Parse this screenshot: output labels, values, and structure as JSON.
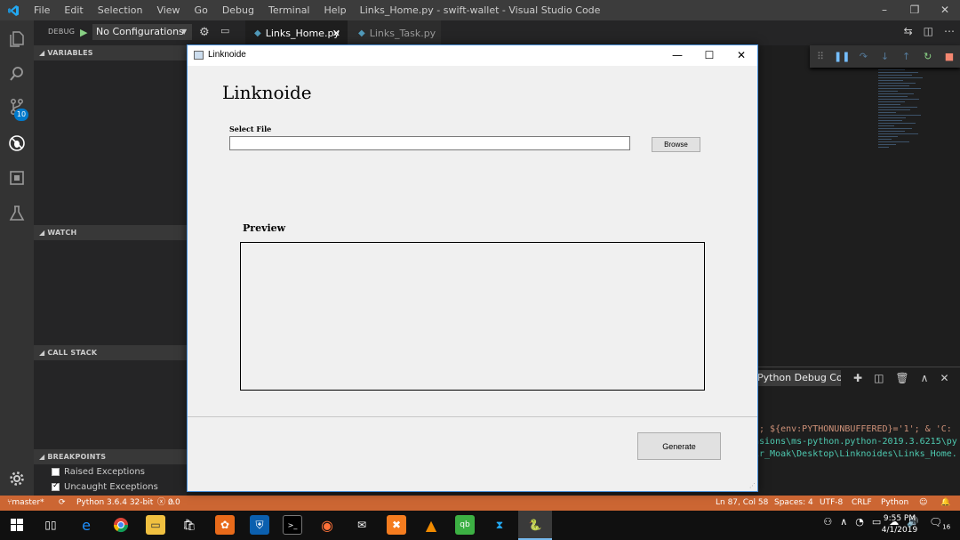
{
  "vscode": {
    "menu": [
      "File",
      "Edit",
      "Selection",
      "View",
      "Go",
      "Debug",
      "Terminal",
      "Help"
    ],
    "window_title": "Links_Home.py - swift-wallet - Visual Studio Code",
    "debug_label": "DEBUG",
    "debug_config": "No Configurations",
    "tabs": [
      {
        "label": "Links_Home.py",
        "active": true
      },
      {
        "label": "Links_Task.py",
        "active": false
      }
    ],
    "scm_badge": "10",
    "sidebar": {
      "variables": "VARIABLES",
      "watch": "WATCH",
      "call_stack": "CALL STACK",
      "breakpoints": "BREAKPOINTS",
      "bp_items": [
        {
          "label": "Raised Exceptions",
          "checked": false
        },
        {
          "label": "Uncaught Exceptions",
          "checked": true
        }
      ]
    },
    "panel": {
      "select": "Python Debug Console",
      "lines": [
        "'; ${env:PYTHONUNBUFFERED}='1'; & 'C:",
        "nsions\\ms-python.python-2019.3.6215\\py",
        "ir_Moak\\Desktop\\Linknoides\\Links_Home."
      ]
    },
    "statusbar": {
      "branch": "master*",
      "python": "Python 3.6.4 32-bit",
      "errors": "0",
      "warnings": "0",
      "position": "Ln 87, Col 58",
      "spaces": "Spaces: 4",
      "encoding": "UTF-8",
      "eol": "CRLF",
      "language": "Python"
    }
  },
  "app": {
    "window_title": "Linknoide",
    "heading": "Linknoide",
    "select_file_label": "Select File",
    "file_value": "",
    "browse_label": "Browse",
    "preview_label": "Preview",
    "generate_label": "Generate"
  },
  "taskbar": {
    "time": "9:55 PM",
    "date": "4/1/2019",
    "notifications": "16"
  },
  "colors": {
    "statusbar": "#cc6633",
    "accent": "#007acc"
  }
}
